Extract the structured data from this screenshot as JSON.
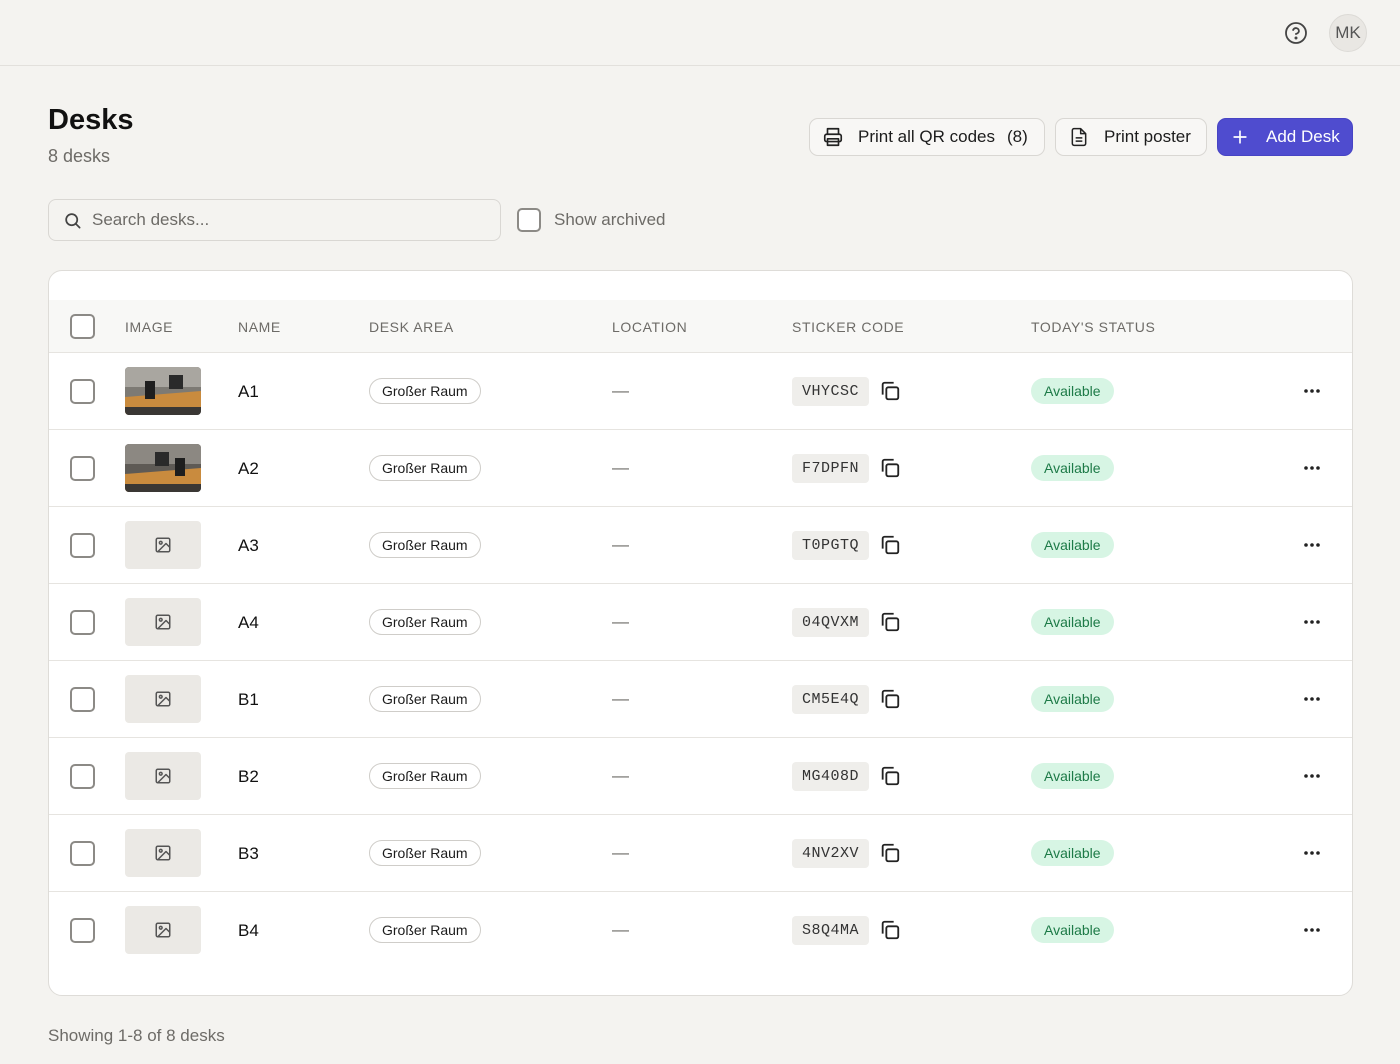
{
  "header": {
    "help_icon": "help-circle-icon",
    "avatar_initials": "MK"
  },
  "page": {
    "title": "Desks",
    "subtitle": "8 desks"
  },
  "actions": {
    "print_qr_label": "Print all QR codes",
    "print_qr_count": "(8)",
    "print_poster_label": "Print poster",
    "add_desk_label": "Add Desk"
  },
  "filters": {
    "search_placeholder": "Search desks...",
    "search_value": "",
    "show_archived_label": "Show archived",
    "show_archived_checked": false
  },
  "table": {
    "columns": {
      "image": "IMAGE",
      "name": "NAME",
      "area": "DESK AREA",
      "location": "LOCATION",
      "sticker": "STICKER CODE",
      "status": "TODAY'S STATUS"
    },
    "rows": [
      {
        "image": "photo",
        "name": "A1",
        "area": "Großer Raum",
        "location": "—",
        "sticker": "VHYCSC",
        "status": "Available"
      },
      {
        "image": "photo",
        "name": "A2",
        "area": "Großer Raum",
        "location": "—",
        "sticker": "F7DPFN",
        "status": "Available"
      },
      {
        "image": "placeholder",
        "name": "A3",
        "area": "Großer Raum",
        "location": "—",
        "sticker": "T0PGTQ",
        "status": "Available"
      },
      {
        "image": "placeholder",
        "name": "A4",
        "area": "Großer Raum",
        "location": "—",
        "sticker": "04QVXM",
        "status": "Available"
      },
      {
        "image": "placeholder",
        "name": "B1",
        "area": "Großer Raum",
        "location": "—",
        "sticker": "CM5E4Q",
        "status": "Available"
      },
      {
        "image": "placeholder",
        "name": "B2",
        "area": "Großer Raum",
        "location": "—",
        "sticker": "MG408D",
        "status": "Available"
      },
      {
        "image": "placeholder",
        "name": "B3",
        "area": "Großer Raum",
        "location": "—",
        "sticker": "4NV2XV",
        "status": "Available"
      },
      {
        "image": "placeholder",
        "name": "B4",
        "area": "Großer Raum",
        "location": "—",
        "sticker": "S8Q4MA",
        "status": "Available"
      }
    ]
  },
  "footer": {
    "pagination_text": "Showing 1-8 of 8 desks"
  },
  "colors": {
    "background": "#f4f3f0",
    "primary": "#4f4ccf",
    "status_available_bg": "#d7f5e4",
    "status_available_text": "#1d7a47"
  }
}
